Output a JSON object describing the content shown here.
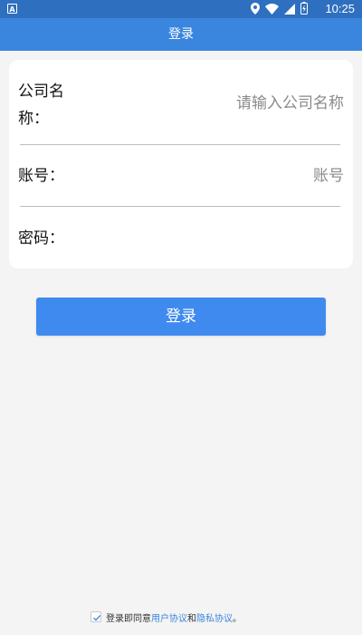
{
  "status_bar": {
    "app_icon_letter": "A",
    "time": "10:25",
    "icons": [
      "location-icon",
      "wifi-icon",
      "signal-icon",
      "battery-charging-icon"
    ]
  },
  "header": {
    "title": "登录"
  },
  "form": {
    "company": {
      "label_line1": "公司名",
      "label_line2": "称：",
      "placeholder": "请输入公司名称",
      "value": ""
    },
    "account": {
      "label": "账号：",
      "placeholder": "账号",
      "value": ""
    },
    "password": {
      "label": "密码：",
      "placeholder": "",
      "value": ""
    }
  },
  "login_button": {
    "label": "登录"
  },
  "agreement": {
    "checked": true,
    "prefix": "登录即同意",
    "user_agreement": "用户协议",
    "and": "和",
    "privacy_agreement": "隐私协议",
    "suffix": "。"
  },
  "colors": {
    "status_bar": "#2f6fbf",
    "title_bar": "#3a86df",
    "button": "#3f8aef",
    "link": "#3a86df",
    "background": "#f4f4f4"
  }
}
